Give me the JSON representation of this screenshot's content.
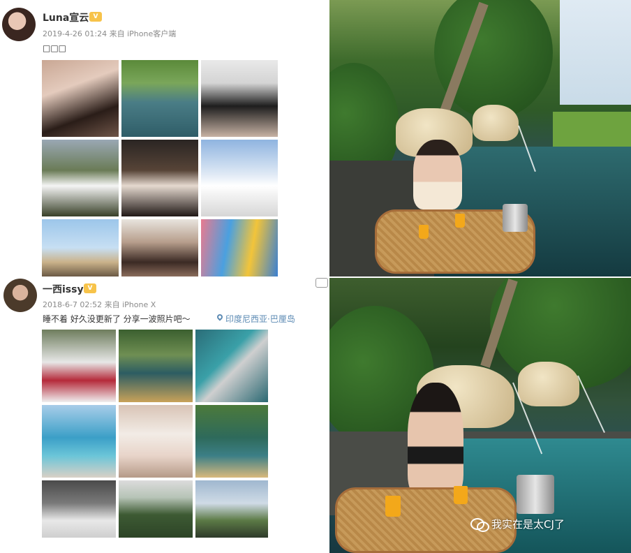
{
  "post1": {
    "username": "Luna宣云",
    "badge": "V",
    "meta": "2019-4-26 01:24 来自 iPhone客户端",
    "text": "□□□"
  },
  "post2": {
    "username": "一西issy",
    "badge": "V",
    "meta": "2018-6-7 02:52 来自 iPhone X",
    "text": "睡不着 好久没更新了 分享一波照片吧～",
    "location": "印度尼西亚·巴厘岛"
  },
  "watermark": {
    "text": "我实在是太CJ了"
  }
}
